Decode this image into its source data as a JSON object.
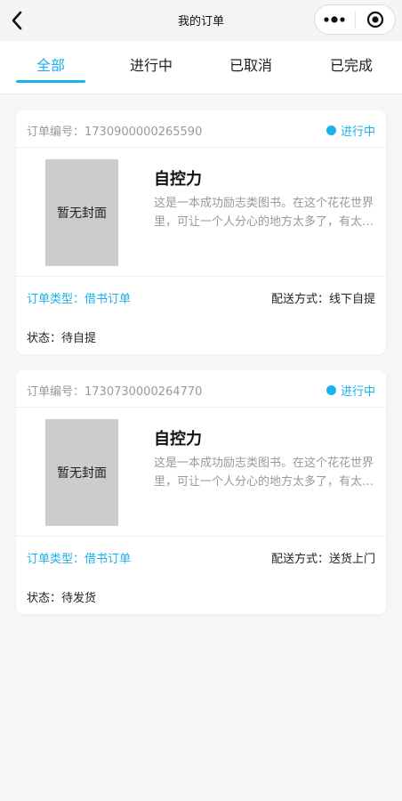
{
  "header": {
    "title": "我的订单",
    "back_icon": "chevron-left-icon",
    "more_icon": "more-dots-icon",
    "close_icon": "target-circle-icon"
  },
  "tabs": [
    {
      "label": "全部",
      "active": true
    },
    {
      "label": "进行中",
      "active": false
    },
    {
      "label": "已取消",
      "active": false
    },
    {
      "label": "已完成",
      "active": false
    }
  ],
  "orders": [
    {
      "order_no_label": "订单编号：",
      "order_no": "1730900000265590",
      "status": "进行中",
      "cover_text": "暂无封面",
      "book_title": "自控力",
      "book_desc": "这是一本成功励志类图书。在这个花花世界里，可让一个人分心的地方太多了，有太多的诱惑和干扰",
      "order_type_label": "订单类型：",
      "order_type": "借书订单",
      "delivery_label": "配送方式：",
      "delivery": "线下自提",
      "state_label": "状态：",
      "state": "待自提"
    },
    {
      "order_no_label": "订单编号：",
      "order_no": "1730730000264770",
      "status": "进行中",
      "cover_text": "暂无封面",
      "book_title": "自控力",
      "book_desc": "这是一本成功励志类图书。在这个花花世界里，可让一个人分心的地方太多了，有太多的诱惑和干扰",
      "order_type_label": "订单类型：",
      "order_type": "借书订单",
      "delivery_label": "配送方式：",
      "delivery": "送货上门",
      "state_label": "状态：",
      "state": "待发货"
    }
  ],
  "colors": {
    "accent": "#1bb0ee",
    "muted_text": "#999999",
    "cover_placeholder": "#cccccc"
  }
}
